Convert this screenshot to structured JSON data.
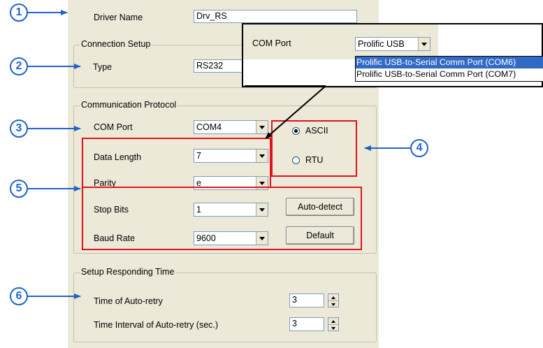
{
  "driver_name": {
    "label": "Driver Name",
    "value": "Drv_RS"
  },
  "connection_setup": {
    "legend": "Connection Setup",
    "type_label": "Type",
    "type_value": "RS232"
  },
  "communication_protocol": {
    "legend": "Communication Protocol",
    "com_port": {
      "label": "COM Port",
      "value": "COM4"
    },
    "data_length": {
      "label": "Data Length",
      "value": "7"
    },
    "parity": {
      "label": "Parity",
      "value": "e"
    },
    "stop_bits": {
      "label": "Stop Bits",
      "value": "1"
    },
    "baud_rate": {
      "label": "Baud Rate",
      "value": "9600"
    },
    "mode_options": [
      {
        "label": "ASCII",
        "selected": true
      },
      {
        "label": "RTU",
        "selected": false
      }
    ],
    "auto_detect_label": "Auto-detect",
    "default_label": "Default"
  },
  "responding_time": {
    "legend": "Setup Responding Time",
    "auto_retry": {
      "label": "Time of Auto-retry",
      "value": "3"
    },
    "retry_interval": {
      "label": "Time Interval of Auto-retry (sec.)",
      "value": "3"
    }
  },
  "com_port_popup": {
    "label": "COM Port",
    "selected": "Prolific USB",
    "options": [
      {
        "label": "Prolific USB-to-Serial Comm Port (COM6)",
        "highlighted": true
      },
      {
        "label": "Prolific USB-to-Serial Comm Port (COM7)",
        "highlighted": false
      }
    ]
  },
  "callouts": [
    "1",
    "2",
    "3",
    "4",
    "5",
    "6"
  ],
  "colors": {
    "callout_blue": "#1f64c8",
    "highlight_red": "#e0141e",
    "panel_bg": "#ece9d8",
    "selection_blue": "#316ac5"
  }
}
